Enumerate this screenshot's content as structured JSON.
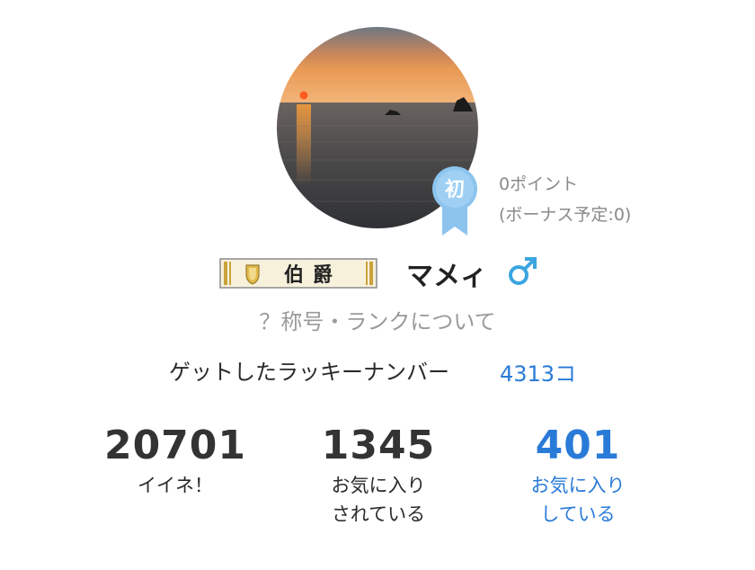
{
  "profile": {
    "username": "マメィ",
    "gender_icon": "male-icon",
    "rank_badge_text": "初",
    "title_badge_text": "伯爵",
    "points_text": "0ポイント",
    "bonus_text": "(ボーナス予定:0)"
  },
  "links": {
    "rank_help": "？称号・ランクについて"
  },
  "lucky": {
    "label": "ゲットしたラッキーナンバー",
    "value": "4313コ"
  },
  "stats": [
    {
      "value": "20701",
      "label_line1": "イイネ！",
      "label_line2": ""
    },
    {
      "value": "1345",
      "label_line1": "お気に入り",
      "label_line2": "されている"
    },
    {
      "value": "401",
      "label_line1": "お気に入り",
      "label_line2": "している"
    }
  ],
  "colors": {
    "link": "#2a7bd8",
    "ribbon": "#8cc4ee",
    "gender": "#3aa5e0",
    "badge_gold": "#c9a23a"
  }
}
